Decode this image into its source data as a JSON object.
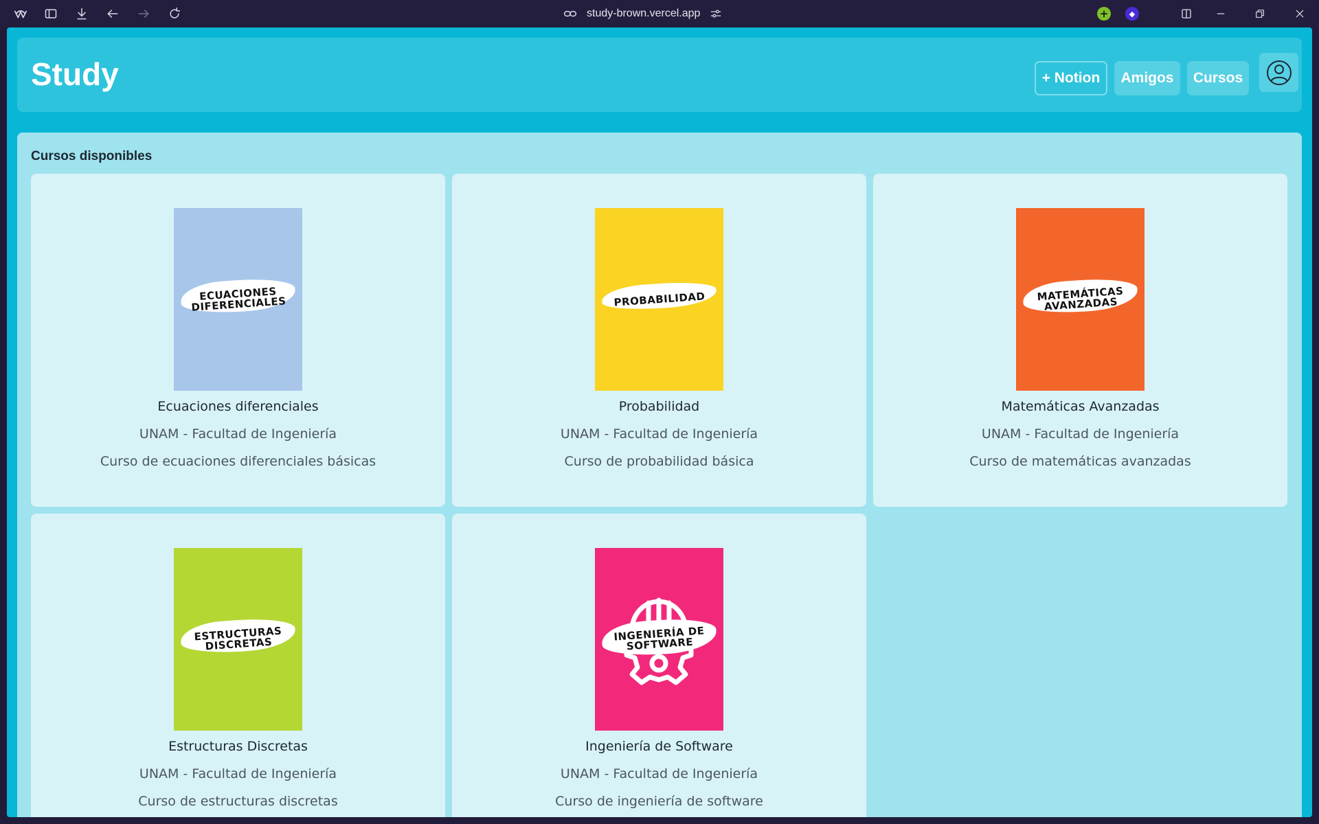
{
  "browser": {
    "url": "study-brown.vercel.app"
  },
  "header": {
    "brand": "Study",
    "nav": {
      "notion": "+ Notion",
      "amigos": "Amigos",
      "cursos": "Cursos"
    }
  },
  "main": {
    "section_title": "Cursos disponibles",
    "courses": [
      {
        "cover_text": "ECUACIONES\nDIFERENCIALES",
        "cover_color": "#a7c6ea",
        "title": "Ecuaciones diferenciales",
        "institution": "UNAM - Facultad de Ingeniería",
        "description": "Curso de ecuaciones diferenciales básicas"
      },
      {
        "cover_text": "PROBABILIDAD",
        "cover_color": "#fad323",
        "title": "Probabilidad",
        "institution": "UNAM - Facultad de Ingeniería",
        "description": "Curso de probabilidad básica"
      },
      {
        "cover_text": "MATEMÁTICAS\nAVANZADAS",
        "cover_color": "#f3662b",
        "title": "Matemáticas Avanzadas",
        "institution": "UNAM - Facultad de Ingeniería",
        "description": "Curso de matemáticas avanzadas"
      },
      {
        "cover_text": "ESTRUCTURAS\nDISCRETAS",
        "cover_color": "#b4d734",
        "title": "Estructuras Discretas",
        "institution": "UNAM - Facultad de Ingeniería",
        "description": "Curso de estructuras discretas"
      },
      {
        "cover_text": "INGENIERÍA DE\nSOFTWARE",
        "cover_color": "#f2297b",
        "title": "Ingeniería de Software",
        "institution": "UNAM - Facultad de Ingeniería",
        "description": "Curso de ingeniería de software"
      }
    ]
  }
}
